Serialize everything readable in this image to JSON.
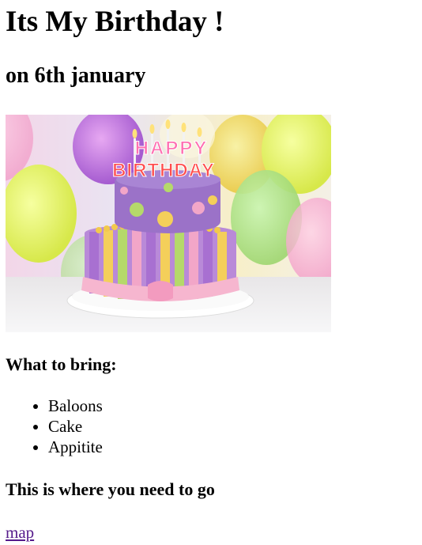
{
  "header": {
    "title": "Its My Birthday !",
    "subtitle": "on 6th january"
  },
  "image": {
    "alt_icon": "birthday-cake-image",
    "topper_line1": "HAPPY",
    "topper_line2": "BIRTHDAY"
  },
  "bring": {
    "heading": "What to bring:",
    "items": [
      {
        "label": "Baloons"
      },
      {
        "label": "Cake"
      },
      {
        "label": "Appitite"
      }
    ]
  },
  "directions": {
    "heading": "This is where you need to go",
    "link_label": "map"
  },
  "colors": {
    "link": "#551a8b",
    "text": "#000000",
    "background": "#ffffff"
  }
}
